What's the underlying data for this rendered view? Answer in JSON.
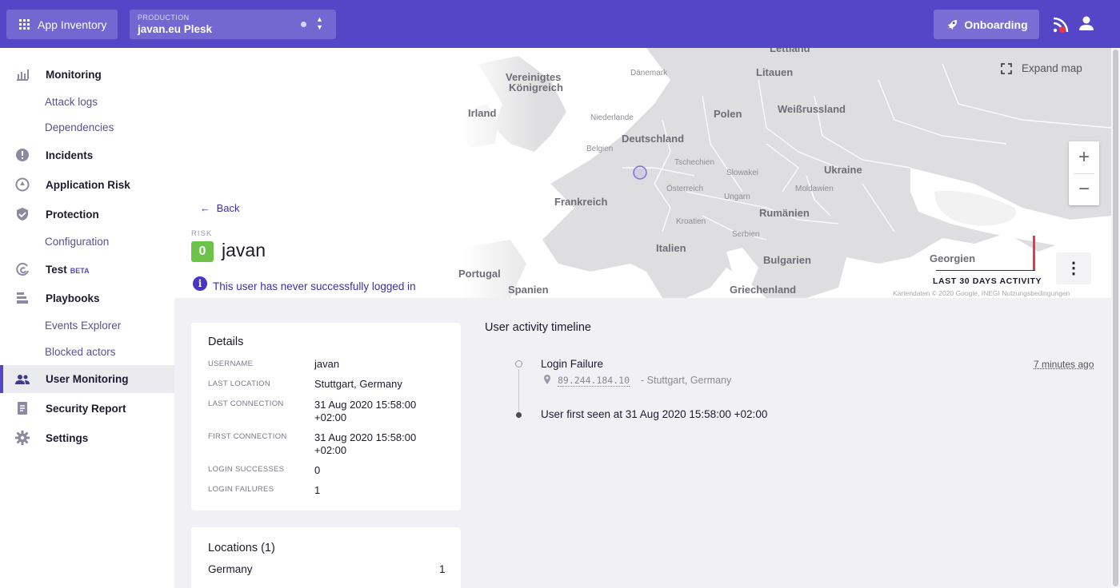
{
  "topbar": {
    "app_inventory_label": "App Inventory",
    "env_label": "PRODUCTION",
    "env_value": "javan.eu Plesk",
    "onboarding_label": "Onboarding"
  },
  "sidebar": {
    "items": [
      {
        "label": "Monitoring",
        "icon": "bar-chart-icon"
      },
      {
        "label": "Attack logs"
      },
      {
        "label": "Dependencies"
      },
      {
        "label": "Incidents",
        "icon": "alert-circle-icon"
      },
      {
        "label": "Application Risk",
        "icon": "risk-gauge-icon"
      },
      {
        "label": "Protection",
        "icon": "shield-icon"
      },
      {
        "label": "Configuration"
      },
      {
        "label": "Test",
        "badge": "BETA",
        "icon": "test-icon"
      },
      {
        "label": "Playbooks",
        "icon": "playbook-icon"
      },
      {
        "label": "Events Explorer"
      },
      {
        "label": "Blocked actors"
      },
      {
        "label": "User Monitoring",
        "icon": "users-icon",
        "active": true
      },
      {
        "label": "Security Report",
        "icon": "report-icon"
      },
      {
        "label": "Settings",
        "icon": "gear-icon"
      }
    ]
  },
  "header": {
    "back_label": "Back",
    "risk_label": "RISK",
    "risk_score": "0",
    "username": "javan",
    "info_message": "This user has never successfully logged in"
  },
  "map": {
    "expand_label": "Expand map",
    "activity_label": "LAST 30 DAYS ACTIVITY",
    "attribution": "Kartendaten © 2020 Google, INEGI   Nutzungsbedingungen",
    "places": {
      "lettland": "Lettland",
      "daenemark": "Dänemark",
      "litauen": "Litauen",
      "vk1": "Vereinigtes",
      "vk2": "Königreich",
      "irland": "Irland",
      "weiss": "Weißrussland",
      "polen": "Polen",
      "niederlande": "Niederlande",
      "deutschland": "Deutschland",
      "belgien": "Belgien",
      "tschechien": "Tschechien",
      "slowakei": "Slowakei",
      "ukraine": "Ukraine",
      "oesterreich": "Österreich",
      "moldawien": "Moldawien",
      "ungarn": "Ungarn",
      "frankreich": "Frankreich",
      "rumaenien": "Rumänien",
      "kroatien": "Kroatien",
      "serbien": "Serbien",
      "italien": "Italien",
      "bulgarien": "Bulgarien",
      "georgien": "Georgien",
      "portugal": "Portugal",
      "spanien": "Spanien",
      "griechenland": "Griechenland"
    }
  },
  "details": {
    "title": "Details",
    "rows": [
      {
        "label": "USERNAME",
        "value": "javan"
      },
      {
        "label": "LAST LOCATION",
        "value": "Stuttgart, Germany"
      },
      {
        "label": "LAST CONNECTION",
        "value_line1": "31 Aug 2020 15:58:00",
        "value_line2": "+02:00"
      },
      {
        "label": "FIRST CONNECTION",
        "value_line1": "31 Aug 2020 15:58:00",
        "value_line2": "+02:00"
      },
      {
        "label": "LOGIN SUCCESSES",
        "value": "0"
      },
      {
        "label": "LOGIN FAILURES",
        "value": "1"
      }
    ]
  },
  "locations": {
    "title": "Locations (1)",
    "rows": [
      {
        "country": "Germany",
        "count": "1"
      }
    ]
  },
  "timeline": {
    "title": "User activity timeline",
    "events": [
      {
        "title": "Login Failure",
        "ip": "89.244.184.10",
        "location": "- Stuttgart, Germany",
        "time": "7 minutes ago"
      },
      {
        "title": "User first seen at 31 Aug 2020 15:58:00 +02:00"
      }
    ]
  },
  "colors": {
    "brand": "#5546c8",
    "risk_ok": "#6cc24a",
    "activity_bar": "#e8384a"
  }
}
